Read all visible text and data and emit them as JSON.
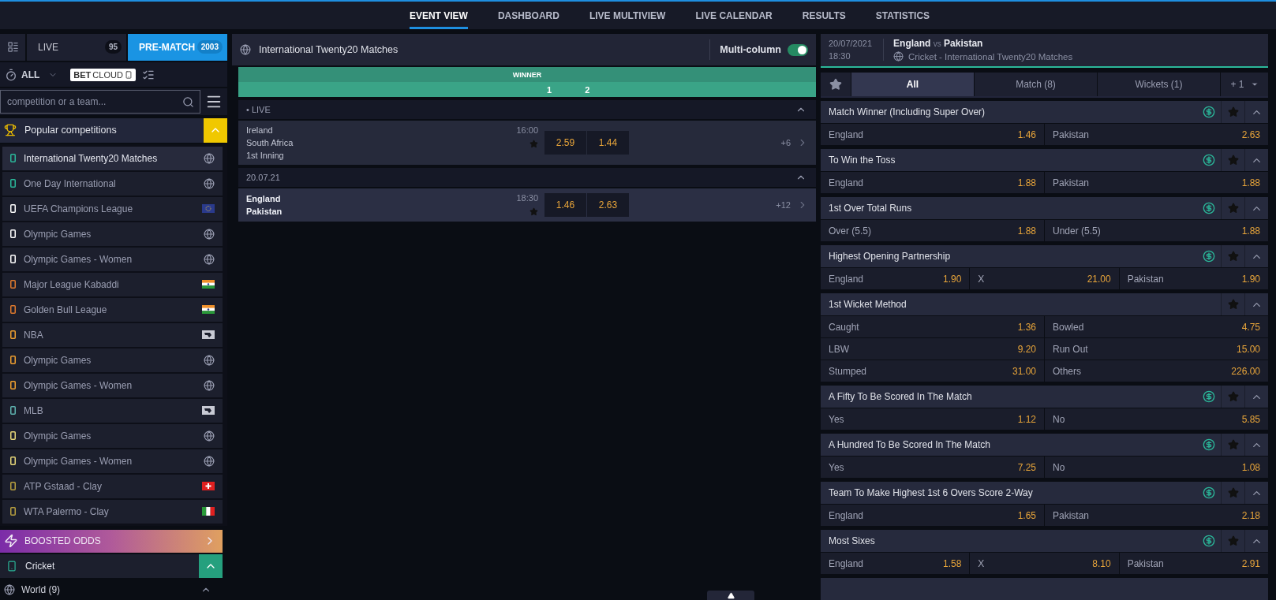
{
  "top_nav": [
    {
      "label": "EVENT VIEW",
      "selected": true
    },
    {
      "label": "DASHBOARD",
      "selected": false
    },
    {
      "label": "LIVE MULTIVIEW",
      "selected": false
    },
    {
      "label": "LIVE CALENDAR",
      "selected": false
    },
    {
      "label": "RESULTS",
      "selected": false
    },
    {
      "label": "STATISTICS",
      "selected": false
    }
  ],
  "sidebar": {
    "mode_tabs": [
      {
        "label": "LIVE",
        "count": "95",
        "selected": false
      },
      {
        "label": "PRE-MATCH",
        "count": "2003",
        "selected": true
      }
    ],
    "filter": {
      "label": "ALL"
    },
    "logo": {
      "bold": "BET",
      "light": "CLOUD"
    },
    "search": {
      "placeholder": "competition or a team..."
    },
    "popular": {
      "title": "Popular competitions",
      "expanded": true
    },
    "items": [
      {
        "name": "International Twenty20 Matches",
        "color": "#2bb89a",
        "kind": "globe",
        "selected": true
      },
      {
        "name": "One Day International",
        "color": "#2bb89a",
        "kind": "globe",
        "selected": false
      },
      {
        "name": "UEFA Champions League",
        "color": "#ffffff",
        "kind": "eu",
        "selected": false
      },
      {
        "name": "Olympic Games",
        "color": "#ffffff",
        "kind": "globe",
        "selected": false
      },
      {
        "name": "Olympic Games - Women",
        "color": "#ffffff",
        "kind": "globe",
        "selected": false
      },
      {
        "name": "Major League Kabaddi",
        "color": "#e07a2e",
        "kind": "india",
        "selected": false
      },
      {
        "name": "Golden Bull League",
        "color": "#e07a2e",
        "kind": "india",
        "selected": false
      },
      {
        "name": "NBA",
        "color": "#f0a030",
        "kind": "usa",
        "selected": false
      },
      {
        "name": "Olympic Games",
        "color": "#f0a030",
        "kind": "globe",
        "selected": false
      },
      {
        "name": "Olympic Games - Women",
        "color": "#f0a030",
        "kind": "globe",
        "selected": false
      },
      {
        "name": "MLB",
        "color": "#5fb3b0",
        "kind": "usa",
        "selected": false
      },
      {
        "name": "Olympic Games",
        "color": "#e8d87a",
        "kind": "globe",
        "selected": false
      },
      {
        "name": "Olympic Games - Women",
        "color": "#e8d87a",
        "kind": "globe",
        "selected": false
      },
      {
        "name": "ATP Gstaad - Clay",
        "color": "#b8a040",
        "kind": "swiss",
        "selected": false
      },
      {
        "name": "WTA Palermo - Clay",
        "color": "#b8a040",
        "kind": "italy",
        "selected": false
      }
    ],
    "boosted": {
      "title": "BOOSTED ODDS"
    },
    "sport": {
      "name": "Cricket",
      "expanded": true
    },
    "region": {
      "name": "World (9)",
      "expanded": true
    }
  },
  "center": {
    "title": "International Twenty20 Matches",
    "multi_column": {
      "label": "Multi-column",
      "on": true
    },
    "market_header": {
      "title": "WINNER",
      "columns": [
        "1",
        "2"
      ]
    },
    "groups": [
      {
        "title": "• LIVE",
        "expanded": true,
        "events": [
          {
            "teams": [
              "Ireland",
              "South Africa"
            ],
            "status": "1st Inning",
            "time": "16:00",
            "odds": [
              "2.59",
              "1.44"
            ],
            "more": "+6",
            "selected": false
          }
        ]
      },
      {
        "title": "20.07.21",
        "expanded": true,
        "events": [
          {
            "teams": [
              "England",
              "Pakistan"
            ],
            "time": "18:30",
            "odds": [
              "1.46",
              "2.63"
            ],
            "more": "+12",
            "selected": true
          }
        ]
      }
    ]
  },
  "event": {
    "date": "20/07/2021",
    "time": "18:30",
    "home": "England",
    "vs": "vs",
    "away": "Pakistan",
    "competition": "Cricket - International Twenty20 Matches",
    "tabs": [
      {
        "label": "All",
        "selected": true
      },
      {
        "label": "Match (8)",
        "selected": false
      },
      {
        "label": "Wickets (1)",
        "selected": false
      }
    ],
    "more_tabs": "+ 1",
    "markets": [
      {
        "title": "Match Winner (Including Super Over)",
        "cashout": true,
        "rows": [
          [
            {
              "label": "England",
              "odds": "1.46"
            },
            {
              "label": "Pakistan",
              "odds": "2.63"
            }
          ]
        ]
      },
      {
        "title": "To Win the Toss",
        "cashout": true,
        "rows": [
          [
            {
              "label": "England",
              "odds": "1.88"
            },
            {
              "label": "Pakistan",
              "odds": "1.88"
            }
          ]
        ]
      },
      {
        "title": "1st Over Total Runs",
        "cashout": true,
        "rows": [
          [
            {
              "label": "Over (5.5)",
              "odds": "1.88"
            },
            {
              "label": "Under (5.5)",
              "odds": "1.88"
            }
          ]
        ]
      },
      {
        "title": "Highest Opening Partnership",
        "cashout": true,
        "rows": [
          [
            {
              "label": "England",
              "odds": "1.90"
            },
            {
              "label": "X",
              "odds": "21.00"
            },
            {
              "label": "Pakistan",
              "odds": "1.90"
            }
          ]
        ]
      },
      {
        "title": "1st Wicket Method",
        "cashout": false,
        "rows": [
          [
            {
              "label": "Caught",
              "odds": "1.36"
            },
            {
              "label": "Bowled",
              "odds": "4.75"
            }
          ],
          [
            {
              "label": "LBW",
              "odds": "9.20"
            },
            {
              "label": "Run Out",
              "odds": "15.00"
            }
          ],
          [
            {
              "label": "Stumped",
              "odds": "31.00"
            },
            {
              "label": "Others",
              "odds": "226.00"
            }
          ]
        ]
      },
      {
        "title": "A Fifty To Be Scored In The Match",
        "cashout": true,
        "rows": [
          [
            {
              "label": "Yes",
              "odds": "1.12"
            },
            {
              "label": "No",
              "odds": "5.85"
            }
          ]
        ]
      },
      {
        "title": "A Hundred To Be Scored In The Match",
        "cashout": true,
        "rows": [
          [
            {
              "label": "Yes",
              "odds": "7.25"
            },
            {
              "label": "No",
              "odds": "1.08"
            }
          ]
        ]
      },
      {
        "title": "Team To Make Highest 1st 6 Overs Score 2-Way",
        "cashout": true,
        "rows": [
          [
            {
              "label": "England",
              "odds": "1.65"
            },
            {
              "label": "Pakistan",
              "odds": "2.18"
            }
          ]
        ]
      },
      {
        "title": "Most Sixes",
        "cashout": true,
        "rows": [
          [
            {
              "label": "England",
              "odds": "1.58"
            },
            {
              "label": "X",
              "odds": "8.10"
            },
            {
              "label": "Pakistan",
              "odds": "2.91"
            }
          ]
        ]
      }
    ]
  }
}
